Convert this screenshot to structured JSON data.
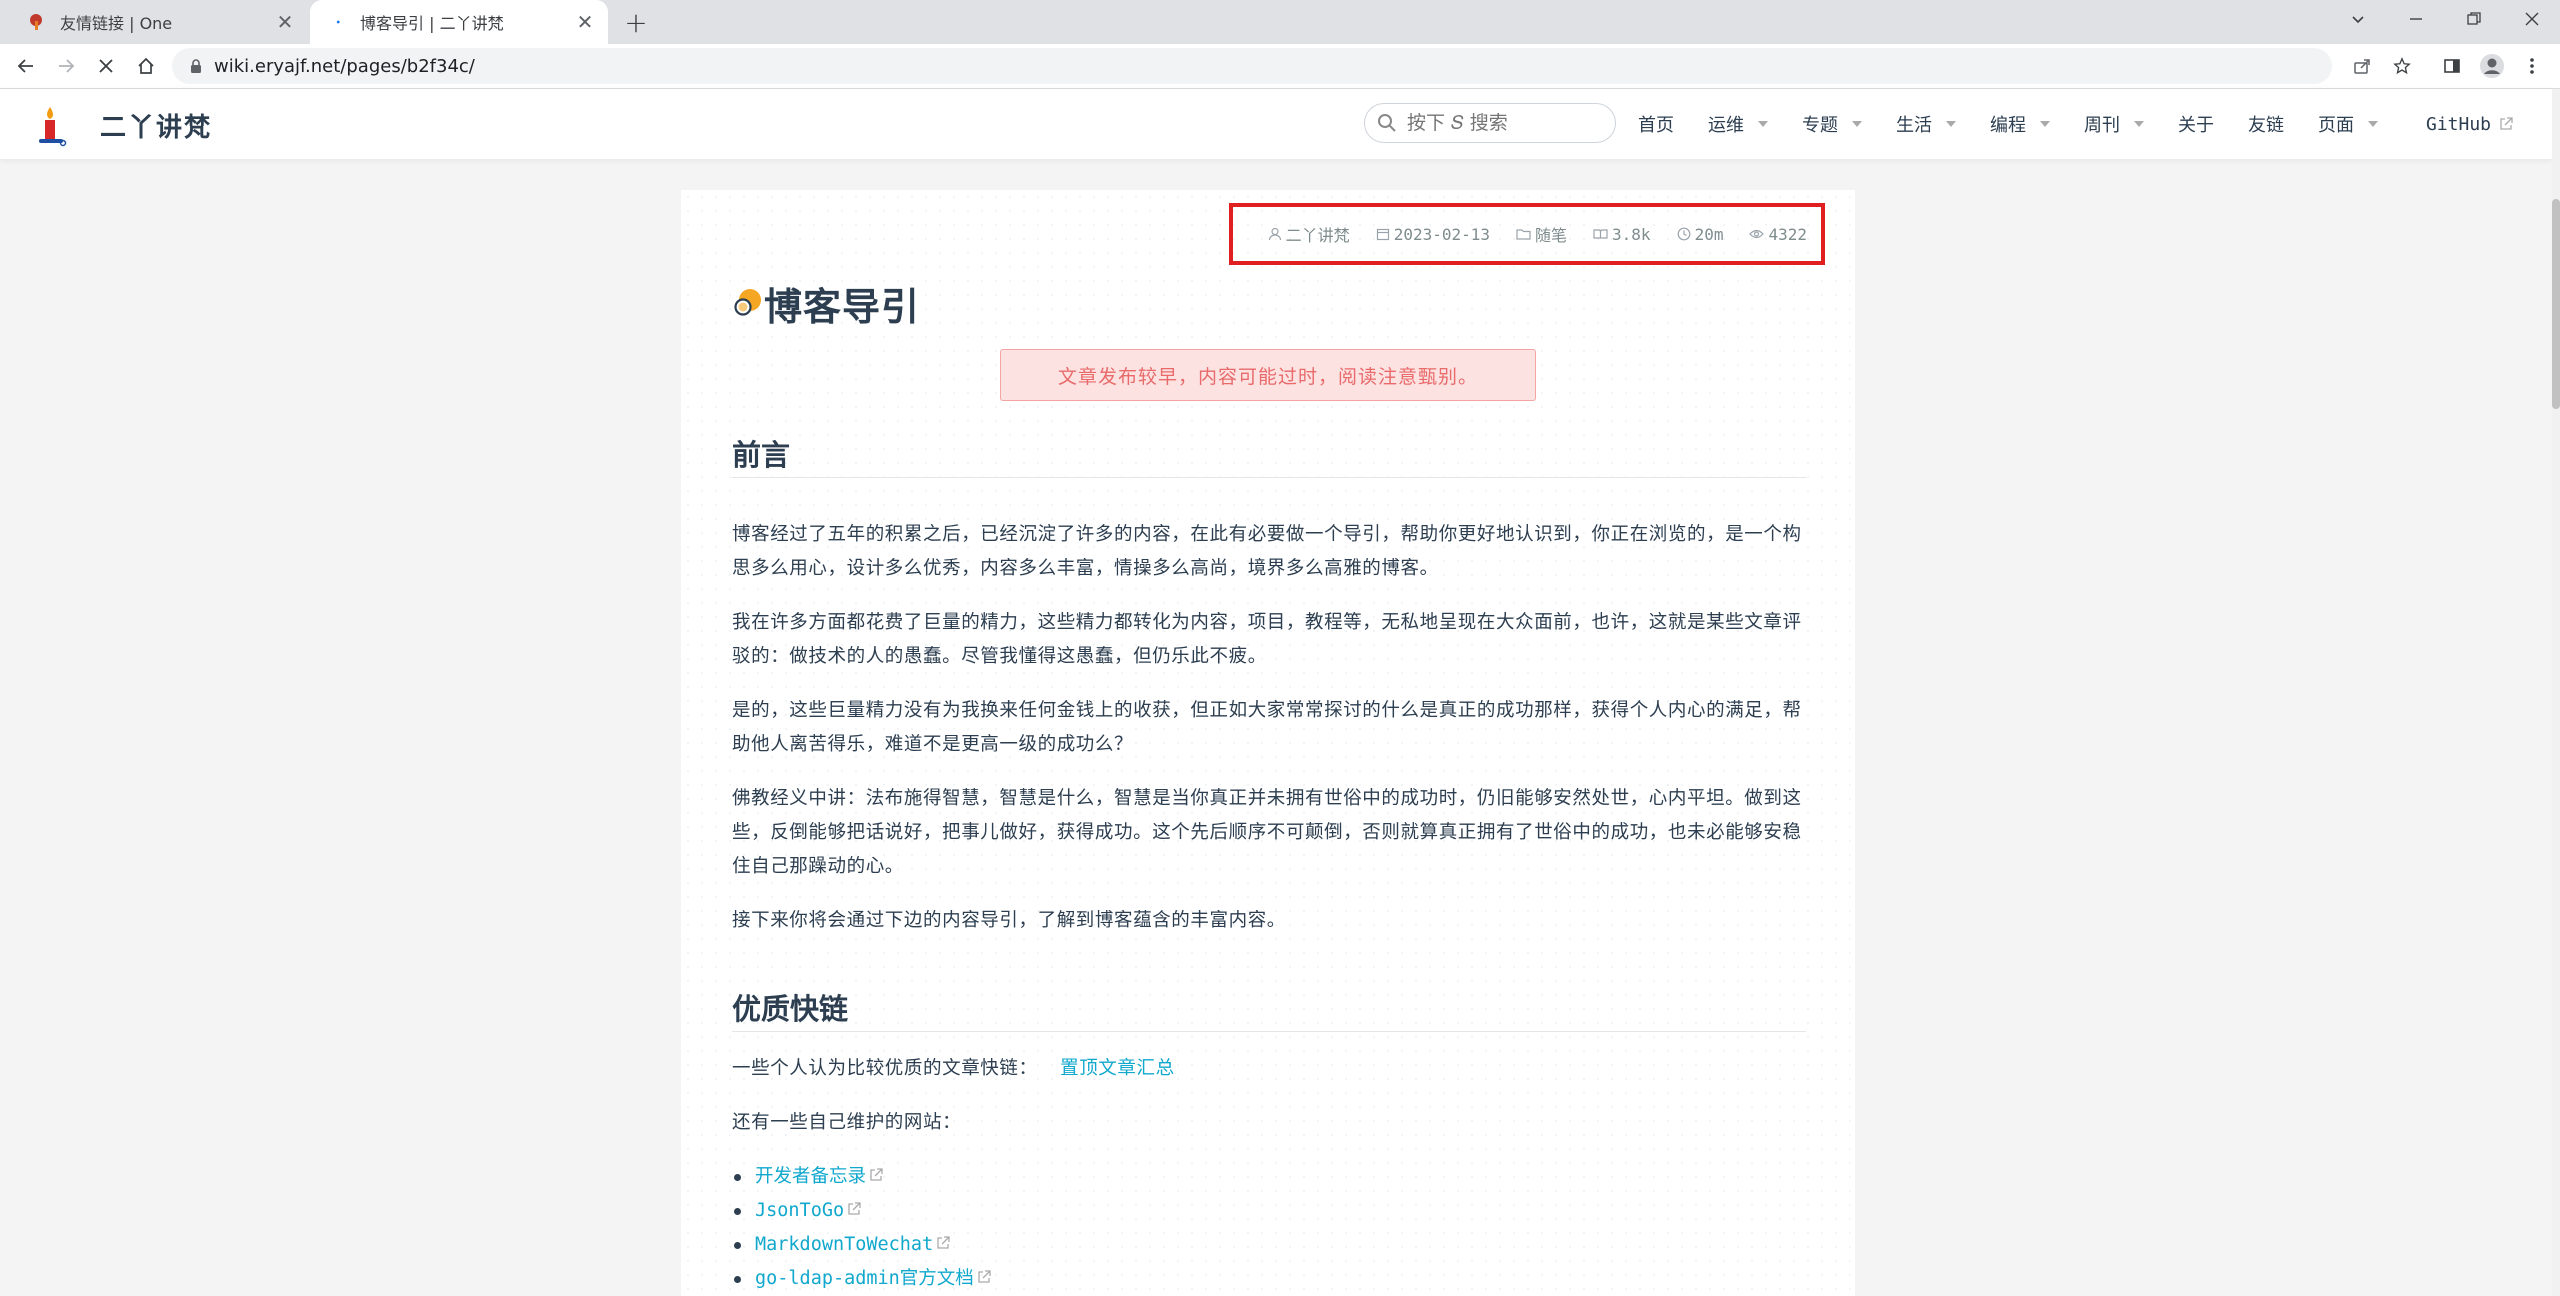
{
  "browser": {
    "tabs": [
      {
        "title": "友情链接 | One",
        "active": false
      },
      {
        "title": "博客导引 | 二丫讲梵",
        "active": true
      }
    ],
    "url": "wiki.eryajf.net/pages/b2f34c/"
  },
  "site": {
    "name": "二丫讲梵",
    "search_placeholder": "按下 𝑆 搜索",
    "nav": [
      {
        "label": "首页",
        "dropdown": false
      },
      {
        "label": "运维",
        "dropdown": true
      },
      {
        "label": "专题",
        "dropdown": true
      },
      {
        "label": "生活",
        "dropdown": true
      },
      {
        "label": "编程",
        "dropdown": true
      },
      {
        "label": "周刊",
        "dropdown": true
      },
      {
        "label": "关于",
        "dropdown": false
      },
      {
        "label": "友链",
        "dropdown": false
      },
      {
        "label": "页面",
        "dropdown": true
      }
    ],
    "github_label": "GitHub"
  },
  "article": {
    "meta": {
      "author": "二丫讲梵",
      "date": "2023-02-13",
      "category": "随笔",
      "words": "3.8k",
      "read_time": "20m",
      "views": "4322"
    },
    "title": "博客导引",
    "notice": "文章发布较早，内容可能过时，阅读注意甄别。",
    "section1": {
      "heading": "前言",
      "paragraphs": [
        "博客经过了五年的积累之后，已经沉淀了许多的内容，在此有必要做一个导引，帮助你更好地认识到，你正在浏览的，是一个构思多么用心，设计多么优秀，内容多么丰富，情操多么高尚，境界多么高雅的博客。",
        "我在许多方面都花费了巨量的精力，这些精力都转化为内容，项目，教程等，无私地呈现在大众面前，也许，这就是某些文章评驳的：做技术的人的愚蠢。尽管我懂得这愚蠢，但仍乐此不疲。",
        "是的，这些巨量精力没有为我换来任何金钱上的收获，但正如大家常常探讨的什么是真正的成功那样，获得个人内心的满足，帮助他人离苦得乐，难道不是更高一级的成功么？",
        "佛教经义中讲：法布施得智慧，智慧是什么，智慧是当你真正并未拥有世俗中的成功时，仍旧能够安然处世，心内平坦。做到这些，反倒能够把话说好，把事儿做好，获得成功。这个先后顺序不可颠倒，否则就算真正拥有了世俗中的成功，也未必能够安稳住自己那躁动的心。",
        "接下来你将会通过下边的内容导引，了解到博客蕴含的丰富内容。"
      ]
    },
    "section2": {
      "heading": "优质快链",
      "line1_text": "一些个人认为比较优质的文章快链：",
      "line1_link": "置顶文章汇总",
      "line2_text": "还有一些自己维护的网站：",
      "sites": [
        "开发者备忘录",
        "JsonToGo",
        "MarkdownToWechat",
        "go-ldap-admin官方文档"
      ]
    }
  },
  "colors": {
    "accent_link": "#11a8cd",
    "highlight_box": "#e02020",
    "notice_bg": "#fde2e2",
    "notice_text": "#e86a6a"
  }
}
